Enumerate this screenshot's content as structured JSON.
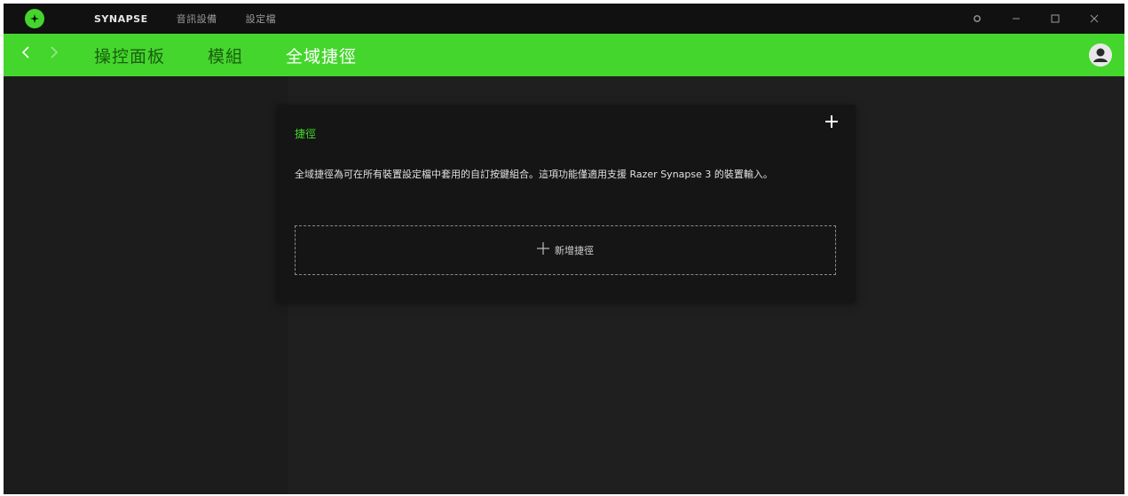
{
  "titlebar": {
    "logo_icon": "razer-logo-icon",
    "nav": [
      {
        "label": "SYNAPSE",
        "active": true
      },
      {
        "label": "音訊設備",
        "active": false
      },
      {
        "label": "設定檔",
        "active": false
      }
    ],
    "controls": {
      "settings_icon": "gear-icon",
      "minimize_icon": "minimize-icon",
      "maximize_icon": "maximize-icon",
      "close_icon": "close-icon"
    }
  },
  "greenbar": {
    "back_icon": "chevron-left-icon",
    "forward_icon": "chevron-right-icon",
    "tabs": [
      {
        "label": "操控面板",
        "active": false
      },
      {
        "label": "模組",
        "active": false
      },
      {
        "label": "全域捷徑",
        "active": true
      }
    ],
    "avatar_icon": "user-avatar-icon"
  },
  "panel": {
    "title": "捷徑",
    "add_icon": "plus-icon",
    "description": "全域捷徑為可在所有裝置設定檔中套用的自訂按鍵組合。這項功能僅適用支援 Razer Synapse 3 的裝置輸入。",
    "add_shortcut_label": "新增捷徑"
  },
  "colors": {
    "accent": "#44d62c",
    "background": "#1f1f1f",
    "panel": "#151515",
    "titlebar": "#111111"
  }
}
